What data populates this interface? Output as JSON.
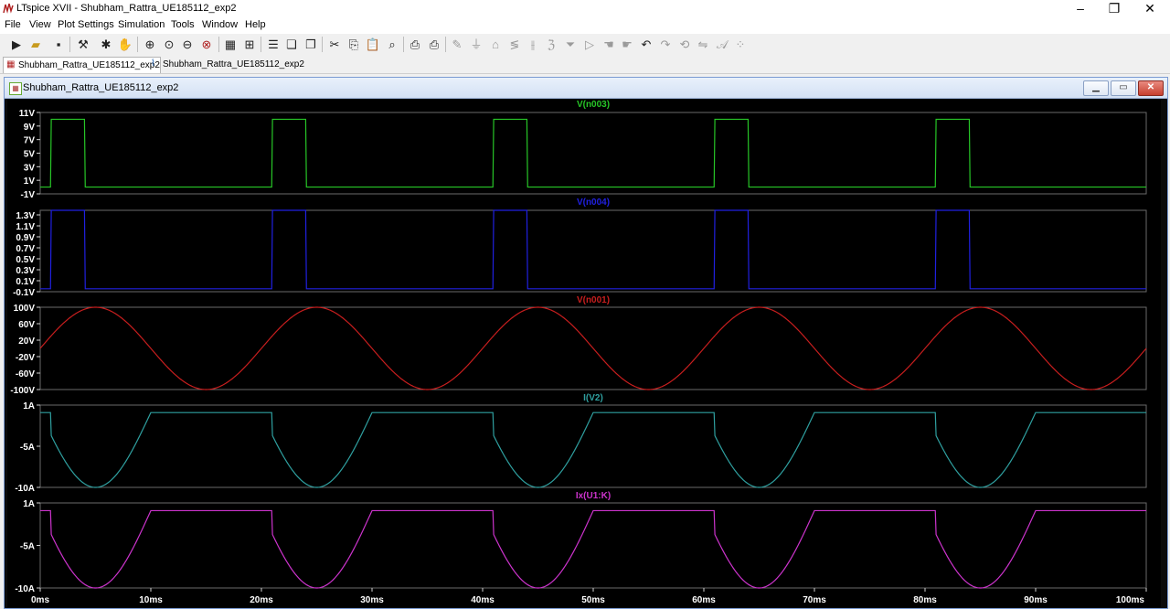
{
  "window": {
    "title": "LTspice XVII - Shubham_Rattra_UE185112_exp2",
    "controls": {
      "minimize": "–",
      "maximize": "❐",
      "close": "✕"
    }
  },
  "menu": {
    "items": [
      "File",
      "View",
      "Plot Settings",
      "Simulation",
      "Tools",
      "Window",
      "Help"
    ]
  },
  "toolbar": {
    "icons": [
      "run-icon",
      "open-icon",
      "save-icon",
      "control-panel-icon",
      "halt-icon",
      "pan-icon",
      "zoom-in-icon",
      "zoom-box-icon",
      "zoom-out-icon",
      "zoom-fit-icon",
      "autorange-icon",
      "fit-icon",
      "tile-horizontal-icon",
      "cascade-icon",
      "tile-vertical-icon",
      "cut-icon",
      "copy-icon",
      "paste-icon",
      "find-icon",
      "print-preview-icon",
      "print-icon",
      "wire-icon",
      "ground-icon",
      "label-icon",
      "resistor-icon",
      "capacitor-icon",
      "inductor-icon",
      "diode-icon",
      "component-icon",
      "move-icon",
      "drag-icon",
      "undo-icon",
      "redo-icon",
      "rotate-icon",
      "mirror-icon",
      "text-icon",
      "spice-directive-icon"
    ]
  },
  "tabs": [
    {
      "label": "Shubham_Rattra_UE185112_exp2",
      "icon": "waveform-icon",
      "active": true
    },
    {
      "label": "Shubham_Rattra_UE185112_exp2",
      "icon": "schematic-icon",
      "active": false
    }
  ],
  "plot_window": {
    "title": "Shubham_Rattra_UE185112_exp2",
    "controls": {
      "minimize": "▁",
      "maximize": "▭",
      "close": "✕"
    }
  },
  "colors": {
    "v_n003": "#27c627",
    "v_n004": "#2020e0",
    "v_n001": "#c81e1e",
    "i_v2": "#2fa0a0",
    "ix_u1k": "#cc33cc",
    "grid_border": "#6a6a6a",
    "background": "#000000"
  },
  "chart_data": {
    "type": "line",
    "x_axis": {
      "range_ms": [
        0,
        100
      ],
      "tick_labels": [
        "0ms",
        "10ms",
        "20ms",
        "30ms",
        "40ms",
        "50ms",
        "60ms",
        "70ms",
        "80ms",
        "90ms",
        "100ms"
      ]
    },
    "panes": [
      {
        "name": "V(n003)",
        "color": "#27c627",
        "ylim": [
          -1,
          11
        ],
        "y_ticks": [
          "11V",
          "9V",
          "7V",
          "5V",
          "3V",
          "1V",
          "-1V"
        ],
        "shape": "pulse",
        "low": 0,
        "high": 10,
        "pulses_ms": [
          [
            1,
            4
          ],
          [
            21,
            24
          ],
          [
            41,
            44
          ],
          [
            61,
            64
          ],
          [
            81,
            84
          ]
        ]
      },
      {
        "name": "V(n004)",
        "color": "#2020e0",
        "ylim": [
          -0.1,
          1.3
        ],
        "y_ticks": [
          "1.3V",
          "1.1V",
          "0.9V",
          "0.7V",
          "0.5V",
          "0.3V",
          "0.1V",
          "-0.1V"
        ],
        "shape": "pulse",
        "low": -0.05,
        "high": 1.3,
        "pulses_ms": [
          [
            1,
            4
          ],
          [
            21,
            24
          ],
          [
            41,
            44
          ],
          [
            61,
            64
          ],
          [
            81,
            84
          ]
        ]
      },
      {
        "name": "V(n001)",
        "color": "#c81e1e",
        "ylim": [
          -100,
          100
        ],
        "y_ticks": [
          "100V",
          "60V",
          "20V",
          "-20V",
          "-60V",
          "-100V"
        ],
        "shape": "sine",
        "amplitude": 100,
        "frequency_hz": 50
      },
      {
        "name": "I(V2)",
        "color": "#2fa0a0",
        "ylim": [
          -10,
          1
        ],
        "y_ticks": [
          "1A",
          "-5A",
          "-10A"
        ],
        "shape": "thyristor_current",
        "amplitude": -10,
        "hold": 0,
        "fire_ms": [
          1,
          21,
          41,
          61,
          81
        ],
        "off_ms": [
          10,
          30,
          50,
          70,
          90
        ]
      },
      {
        "name": "Ix(U1:K)",
        "color": "#cc33cc",
        "ylim": [
          -10,
          1
        ],
        "y_ticks": [
          "1A",
          "-5A",
          "-10A"
        ],
        "shape": "thyristor_current",
        "amplitude": -10,
        "hold": 0,
        "fire_ms": [
          1,
          21,
          41,
          61,
          81
        ],
        "off_ms": [
          10,
          30,
          50,
          70,
          90
        ]
      }
    ]
  }
}
